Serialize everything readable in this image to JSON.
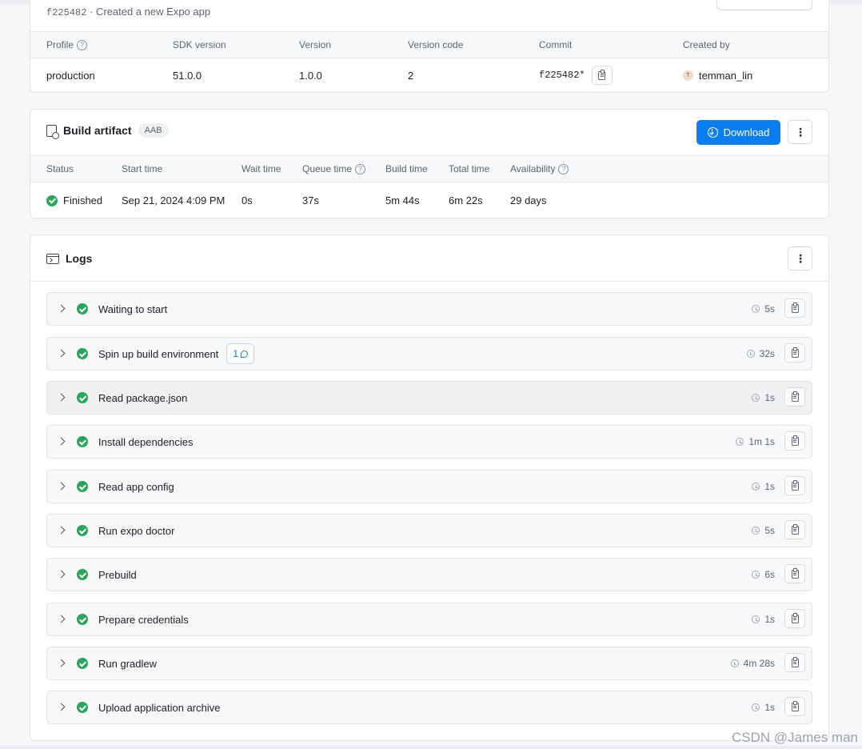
{
  "summary": {
    "commit_hash": "f225482",
    "separator": " · ",
    "commit_message": "Created a new Expo app",
    "columns": [
      "Profile",
      "SDK version",
      "Version",
      "Version code",
      "Commit",
      "Created by"
    ],
    "row": {
      "profile": "production",
      "sdk_version": "51.0.0",
      "version": "1.0.0",
      "version_code": "2",
      "commit": "f225482*",
      "avatar_initial": "T",
      "created_by": "temman_lin"
    }
  },
  "artifact": {
    "title": "Build artifact",
    "badge": "AAB",
    "download_label": "Download",
    "more_label": "⋮",
    "columns": [
      "Status",
      "Start time",
      "Wait time",
      "Queue time",
      "Build time",
      "Total time",
      "Availability"
    ],
    "row": {
      "status": "Finished",
      "start_time": "Sep 21, 2024 4:09 PM",
      "wait_time": "0s",
      "queue_time": "37s",
      "build_time": "5m 44s",
      "total_time": "6m 22s",
      "availability": "29 days"
    },
    "status_color": "#27a65c"
  },
  "logs": {
    "title": "Logs",
    "more_label": "⋮",
    "help_glyph": "?",
    "steps": [
      {
        "name": "Waiting to start",
        "duration": "5s"
      },
      {
        "name": "Spin up build environment",
        "duration": "32s",
        "warning_count": "1"
      },
      {
        "name": "Read package.json",
        "duration": "1s"
      },
      {
        "name": "Install dependencies",
        "duration": "1m 1s"
      },
      {
        "name": "Read app config",
        "duration": "1s"
      },
      {
        "name": "Run expo doctor",
        "duration": "5s"
      },
      {
        "name": "Prebuild",
        "duration": "6s"
      },
      {
        "name": "Prepare credentials",
        "duration": "1s"
      },
      {
        "name": "Run gradlew",
        "duration": "4m 28s"
      },
      {
        "name": "Upload application archive",
        "duration": "1s"
      }
    ]
  },
  "colors": {
    "accent": "#0a7df0",
    "success": "#27a65c"
  },
  "watermark": "CSDN @James man"
}
